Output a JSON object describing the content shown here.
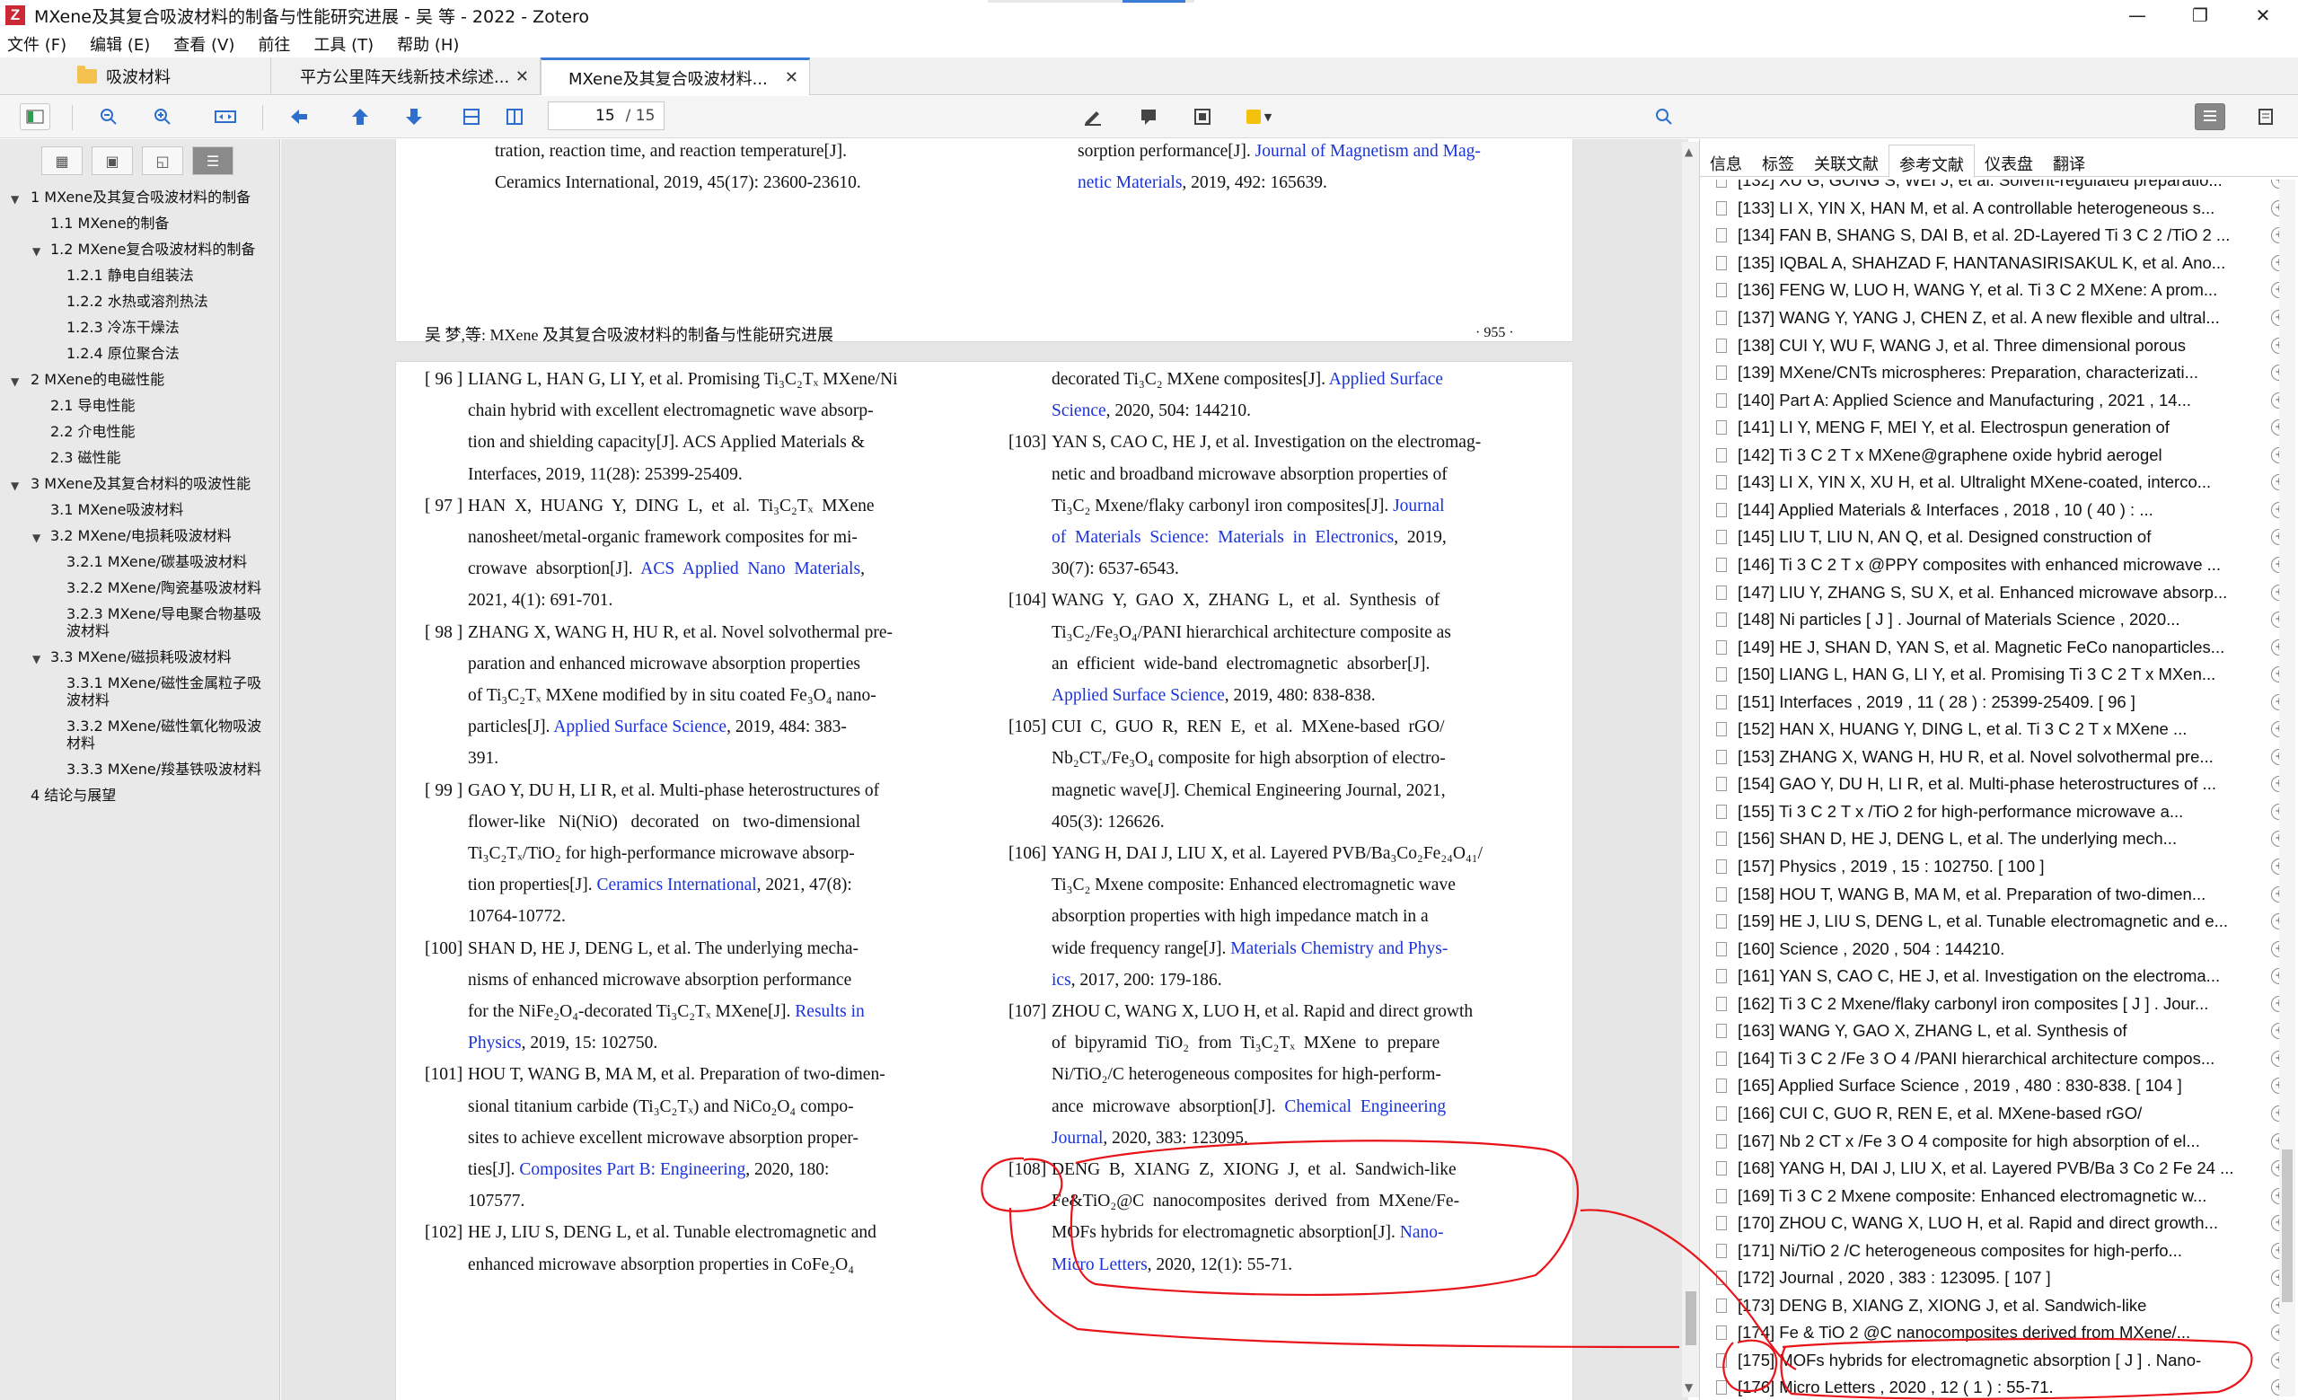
{
  "window": {
    "title": "MXene及其复合吸波材料的制备与性能研究进展 - 吴 等 - 2022 - Zotero",
    "minimize": "—",
    "maximize": "❐",
    "close": "✕"
  },
  "menu": [
    "文件 (F)",
    "编辑 (E)",
    "查看 (V)",
    "前往",
    "工具 (T)",
    "帮助 (H)"
  ],
  "tabs": [
    {
      "label": "吸波材料"
    },
    {
      "label": "平方公里阵天线新技术综述...",
      "close": "✕"
    },
    {
      "label": "MXene及其复合吸波材料...",
      "close": "✕"
    }
  ],
  "toolbar": {
    "page_current": "15",
    "page_total": "/ 15",
    "highlight_color": "#f4c20d"
  },
  "outline": [
    {
      "label": "1 MXene及其复合吸波材料的制备",
      "level": 0,
      "toggle": "▼"
    },
    {
      "label": "1.1 MXene的制备",
      "level": 1
    },
    {
      "label": "1.2 MXene复合吸波材料的制备",
      "level": 1,
      "toggle": "▼"
    },
    {
      "label": "1.2.1 静电自组装法",
      "level": 2
    },
    {
      "label": "1.2.2 水热或溶剂热法",
      "level": 2
    },
    {
      "label": "1.2.3 冷冻干燥法",
      "level": 2
    },
    {
      "label": "1.2.4 原位聚合法",
      "level": 2
    },
    {
      "label": "2 MXene的电磁性能",
      "level": 0,
      "toggle": "▼"
    },
    {
      "label": "2.1 导电性能",
      "level": 1
    },
    {
      "label": "2.2 介电性能",
      "level": 1
    },
    {
      "label": "2.3 磁性能",
      "level": 1
    },
    {
      "label": "3 MXene及其复合材料的吸波性能",
      "level": 0,
      "toggle": "▼"
    },
    {
      "label": "3.1 MXene吸波材料",
      "level": 1
    },
    {
      "label": "3.2 MXene/电损耗吸波材料",
      "level": 1,
      "toggle": "▼"
    },
    {
      "label": "3.2.1 MXene/碳基吸波材料",
      "level": 2
    },
    {
      "label": "3.2.2 MXene/陶瓷基吸波材料",
      "level": 2
    },
    {
      "label": "3.2.3 MXene/导电聚合物基吸波材料",
      "level": 2
    },
    {
      "label": "3.3 MXene/磁损耗吸波材料",
      "level": 1,
      "toggle": "▼"
    },
    {
      "label": "3.3.1 MXene/磁性金属粒子吸波材料",
      "level": 2
    },
    {
      "label": "3.3.2 MXene/磁性氧化物吸波材料",
      "level": 2
    },
    {
      "label": "3.3.3 MXene/羧基铁吸波材料",
      "level": 2
    },
    {
      "label": "4 结论与展望",
      "level": 0
    }
  ],
  "document": {
    "top_left": [
      "tration,  reaction  time,  and  reaction  temperature[J].",
      "Ceramics International, 2019, 45(17): 23600-23610."
    ],
    "top_right_prefix": "sorption performance[J]. ",
    "top_right_link1": "Journal of Magnetism and Mag-",
    "top_right_link2": "netic Materials",
    "top_right_suffix": ", 2019, 492: 165639.",
    "running_head": "吴   梦,等:  MXene 及其复合吸波材料的制备与性能研究进展",
    "page_number": "· 955 ·",
    "left_refs": [
      {
        "num": "[ 96 ]",
        "lines": [
          [
            "LIANG L, HAN G, LI Y, et al. Promising Ti₃C₂Tₓ MXene/Ni"
          ],
          [
            "chain hybrid with excellent electromagnetic wave absorp-"
          ],
          [
            "tion and shielding capacity[J]. ACS Applied Materials &"
          ],
          [
            "Interfaces, 2019, 11(28): 25399-25409."
          ]
        ]
      },
      {
        "num": "[ 97 ]",
        "lines": [
          [
            "HAN  X,  HUANG  Y,  DING  L,  et  al.  Ti₃C₂Tₓ  MXene"
          ],
          [
            "nanosheet/metal-organic framework composites for mi-"
          ],
          [
            "crowave  absorption[J].  ",
            {
              "link": "ACS  Applied  Nano  Materials"
            },
            ","
          ],
          [
            "2021, 4(1): 691-701."
          ]
        ]
      },
      {
        "num": "[ 98 ]",
        "lines": [
          [
            "ZHANG X, WANG H, HU R, et al. Novel solvothermal pre-"
          ],
          [
            "paration and enhanced microwave absorption properties"
          ],
          [
            "of Ti₃C₂Tₓ MXene modified by in situ coated Fe₃O₄ nano-"
          ],
          [
            "particles[J]. ",
            {
              "link": "Applied Surface Science"
            },
            ", 2019, 484: 383-"
          ],
          [
            "391."
          ]
        ]
      },
      {
        "num": "[ 99 ]",
        "lines": [
          [
            "GAO Y, DU H, LI R, et al. Multi-phase heterostructures of"
          ],
          [
            "flower-like   Ni(NiO)   decorated   on   two-dimensional"
          ],
          [
            "Ti₃C₂Tₓ/TiO₂ for high-performance microwave absorp-"
          ],
          [
            "tion properties[J]. ",
            {
              "link": "Ceramics International"
            },
            ", 2021, 47(8):"
          ],
          [
            "10764-10772."
          ]
        ]
      },
      {
        "num": "[100]",
        "lines": [
          [
            "SHAN D, HE J, DENG L, et al. The underlying mecha-"
          ],
          [
            "nisms of enhanced microwave absorption performance"
          ],
          [
            "for the NiFe₂O₄-decorated Ti₃C₂Tₓ MXene[J]. ",
            {
              "link": "Results in"
            }
          ],
          [
            {
              "link": "Physics"
            },
            ", 2019, 15: 102750."
          ]
        ]
      },
      {
        "num": "[101]",
        "lines": [
          [
            "HOU T, WANG B, MA M, et al. Preparation of two-dimen-"
          ],
          [
            "sional titanium carbide (Ti₃C₂Tₓ) and NiCo₂O₄ compo-"
          ],
          [
            "sites to achieve excellent microwave absorption proper-"
          ],
          [
            "ties[J]. ",
            {
              "link": "Composites Part B: Engineering"
            },
            ", 2020, 180:"
          ],
          [
            "107577."
          ]
        ]
      },
      {
        "num": "[102]",
        "lines": [
          [
            "HE J, LIU S, DENG L, et al. Tunable electromagnetic and"
          ],
          [
            "enhanced microwave absorption properties in CoFe₂O₄"
          ]
        ]
      }
    ],
    "right_refs": [
      {
        "num": "",
        "lines": [
          [
            "decorated Ti₃C₂ MXene composites[J]. ",
            {
              "link": "Applied Surface"
            }
          ],
          [
            {
              "link": "Science"
            },
            ", 2020, 504: 144210."
          ]
        ]
      },
      {
        "num": "[103]",
        "lines": [
          [
            "YAN S, CAO C, HE J, et al. Investigation on the electromag-"
          ],
          [
            "netic and broadband microwave absorption properties of"
          ],
          [
            "Ti₃C₂ Mxene/flaky carbonyl iron composites[J]. ",
            {
              "link": "Journal"
            }
          ],
          [
            {
              "link": "of  Materials  Science:  Materials  in  Electronics"
            },
            ",  2019,"
          ],
          [
            "30(7): 6537-6543."
          ]
        ]
      },
      {
        "num": "[104]",
        "lines": [
          [
            "WANG  Y,  GAO  X,  ZHANG  L,  et  al.  Synthesis  of"
          ],
          [
            "Ti₃C₂/Fe₃O₄/PANI hierarchical architecture composite as"
          ],
          [
            "an  efficient  wide-band  electromagnetic  absorber[J]."
          ],
          [
            {
              "link": "Applied Surface Science"
            },
            ", 2019, 480: 838-838."
          ]
        ]
      },
      {
        "num": "[105]",
        "lines": [
          [
            "CUI  C,  GUO  R,  REN  E,  et  al.  MXene-based  rGO/"
          ],
          [
            "Nb₂CTₓ/Fe₃O₄ composite for high absorption of electro-"
          ],
          [
            "magnetic wave[J]. Chemical Engineering Journal, 2021,"
          ],
          [
            "405(3): 126626."
          ]
        ]
      },
      {
        "num": "[106]",
        "lines": [
          [
            "YANG H, DAI J, LIU X, et al. Layered PVB/Ba₃Co₂Fe₂₄O₄₁/"
          ],
          [
            "Ti₃C₂ Mxene composite: Enhanced electromagnetic wave"
          ],
          [
            "absorption properties with high impedance match in a"
          ],
          [
            "wide frequency range[J]. ",
            {
              "link": "Materials Chemistry and Phys-"
            }
          ],
          [
            {
              "link": "ics"
            },
            ", 2017, 200: 179-186."
          ]
        ]
      },
      {
        "num": "[107]",
        "lines": [
          [
            "ZHOU C, WANG X, LUO H, et al. Rapid and direct growth"
          ],
          [
            "of  bipyramid  TiO₂  from  Ti₃C₂Tₓ  MXene  to  prepare"
          ],
          [
            "Ni/TiO₂/C heterogeneous composites for high-perform-"
          ],
          [
            "ance  microwave  absorption[J].  ",
            {
              "link": "Chemical  Engineering"
            }
          ],
          [
            {
              "link": "Journal"
            },
            ", 2020, 383: 123095."
          ]
        ]
      },
      {
        "num": "[108]",
        "lines": [
          [
            "DENG  B,  XIANG  Z,  XIONG  J,  et  al.  Sandwich-like"
          ],
          [
            "Fe&TiO₂@C  nanocomposites  derived  from  MXene/Fe-"
          ],
          [
            "MOFs hybrids for electromagnetic absorption[J]. ",
            {
              "link": "Nano-"
            }
          ],
          [
            {
              "link": "Micro Letters"
            },
            ", 2020, 12(1): 55-71."
          ]
        ]
      }
    ]
  },
  "right_panel": {
    "tabs": [
      "信息",
      "标签",
      "关联文献",
      "参考文献",
      "仪表盘",
      "翻译"
    ],
    "active_tab": "参考文献",
    "items": [
      "[132] XU G, GONG S, WEI J, et al. Solvent-regulated preparatio...",
      "[133] LI X, YIN X, HAN M, et al. A controllable heterogeneous s...",
      "[134] FAN B, SHANG S, DAI B, et al. 2D-Layered Ti 3 C 2 /TiO 2 ...",
      "[135] IQBAL A, SHAHZAD F, HANTANASIRISAKUL K, et al. Ano...",
      "[136] FENG W, LUO H, WANG Y, et al. Ti 3 C 2  MXene: A prom...",
      "[137] WANG Y, YANG J, CHEN Z, et al. A new flexible and ultral...",
      "[138] CUI Y, WU F, WANG J, et al. Three dimensional porous",
      "[139] MXene/CNTs microspheres: Preparation, characterizati...",
      "[140] Part A: Applied Science and Manufacturing ,  2021 ,  14...",
      "[141] LI Y, MENG F, MEI Y, et al. Electrospun generation of",
      "[142] Ti 3 C 2 T x   MXene@graphene oxide hybrid aerogel",
      "[143] LI X, YIN X, XU H, et al. Ultralight MXene-coated, interco...",
      "[144] Applied Materials  &  Interfaces ,  2018 ,  10 ( 40 ) :  ...",
      "[145] LIU T, LIU N, AN Q, et al. Designed construction of",
      "[146] Ti 3 C 2 T x @PPY composites with enhanced microwave ...",
      "[147] LIU Y, ZHANG S, SU X, et al. Enhanced microwave absorp...",
      "[148] Ni particles [ J ] . Journal of Materials Science ,  2020...",
      "[149] HE J, SHAN D, YAN S, et al. Magnetic FeCo nanoparticles...",
      "[150] LIANG L, HAN G, LI Y, et al. Promising Ti 3 C 2 T x  MXen...",
      "[151] Interfaces ,  2019 ,  11 ( 28 ) :  25399-25409. [ 96 ]",
      "[152] HAN X, HUANG Y, DING L, et al. Ti 3 C 2 T x MXene ...",
      "[153] ZHANG X, WANG H, HU R, et al. Novel solvothermal pre...",
      "[154] GAO Y, DU H, LI R, et al. Multi-phase heterostructures of ...",
      "[155] Ti 3 C 2 T x /TiO 2   for high-performance microwave  a...",
      "[156] SHAN D, HE J, DENG L, et al. The underlying mech...",
      "[157] Physics ,  2019 ,  15 :  102750. [ 100 ]",
      "[158] HOU T, WANG B, MA M, et al. Preparation of two-dimen...",
      "[159] HE J, LIU S, DENG L, et al. Tunable electromagnetic and e...",
      "[160] Science ,  2020 ,  504 :  144210.",
      "[161] YAN S, CAO C, HE J, et al. Investigation on the electroma...",
      "[162] Ti 3 C 2  Mxene/flaky carbonyl iron composites [ J ] . Jour...",
      "[163] WANG Y, GAO X, ZHANG L, et al. Synthesis of",
      "[164] Ti 3 C 2 /Fe 3 O 4 /PANI hierarchical architecture compos...",
      "[165] Applied Surface Science ,  2019 ,  480 :  830-838. [ 104 ]",
      "[166] CUI C, GUO R, REN E, et al. MXene-based rGO/",
      "[167] Nb 2 CT x /Fe 3 O 4  composite for high absorption of el...",
      "[168] YANG H, DAI J, LIU X, et al. Layered PVB/Ba 3 Co 2 Fe 24 ...",
      "[169] Ti 3 C 2  Mxene composite: Enhanced electromagnetic w...",
      "[170] ZHOU C, WANG X, LUO H, et al. Rapid and direct growth...",
      "[171] Ni/TiO 2 /C heterogeneous composites for high-perfo...",
      "[172] Journal ,  2020 ,  383 :  123095. [ 107 ]",
      "[173] DENG B, XIANG Z, XIONG J, et al. Sandwich-like",
      "[174] Fe & TiO 2 @C nanocomposites derived from MXene/...",
      "[175] MOFs hybrids for electromagnetic absorption [ J ] . Nano-",
      "[176] Micro Letters ,  2020 ,  12 ( 1 ) :  55-71."
    ]
  },
  "colors": {
    "accent": "#3b7bd6",
    "link": "#1a33d8",
    "annotation": "#e8141a"
  }
}
